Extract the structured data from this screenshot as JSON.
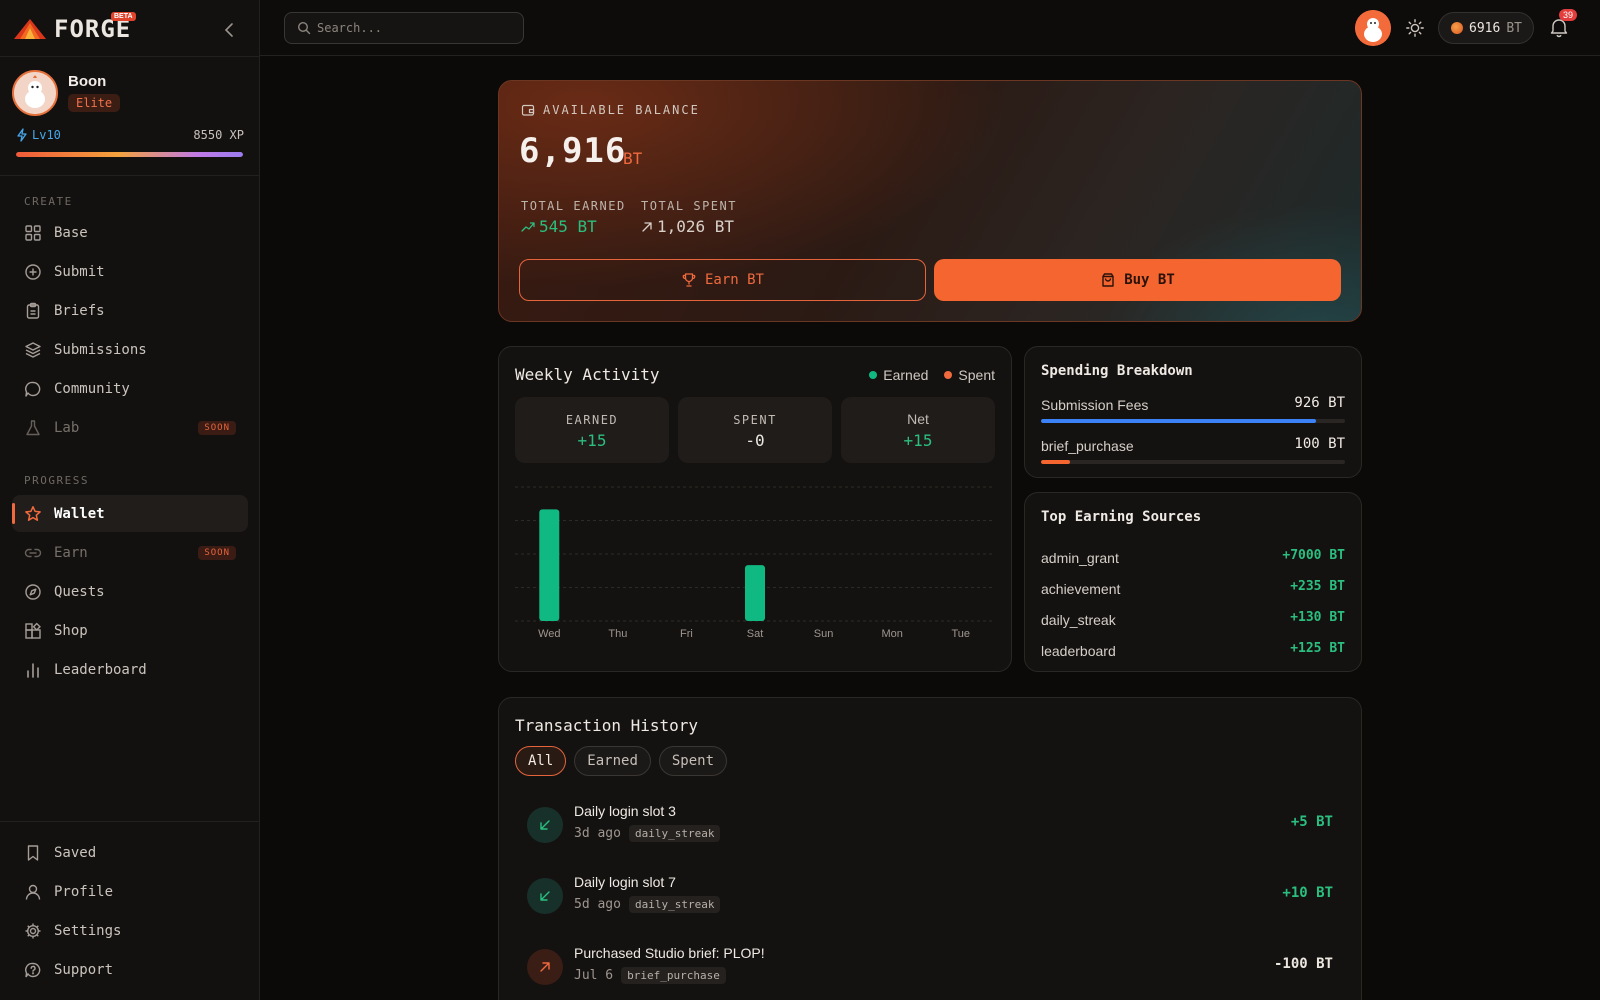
{
  "app": {
    "name": "FORGE",
    "badge": "BETA"
  },
  "user": {
    "name": "Boon",
    "rank": "Elite",
    "level": "Lv10",
    "xp": "8550 XP",
    "xp_progress": 1.0
  },
  "sidebar": {
    "create_label": "CREATE",
    "create_items": [
      {
        "label": "Base",
        "icon": "grid-icon"
      },
      {
        "label": "Submit",
        "icon": "plus-circle-icon"
      },
      {
        "label": "Briefs",
        "icon": "clipboard-icon"
      },
      {
        "label": "Submissions",
        "icon": "layers-icon"
      },
      {
        "label": "Community",
        "icon": "chat-icon"
      },
      {
        "label": "Lab",
        "icon": "flask-icon",
        "badge": "SOON"
      }
    ],
    "progress_label": "PROGRESS",
    "progress_items": [
      {
        "label": "Wallet",
        "icon": "star-icon"
      },
      {
        "label": "Earn",
        "icon": "link-icon",
        "badge": "SOON"
      },
      {
        "label": "Quests",
        "icon": "compass-icon"
      },
      {
        "label": "Shop",
        "icon": "shop-icon"
      },
      {
        "label": "Leaderboard",
        "icon": "bar-chart-icon"
      }
    ],
    "bottom_items": [
      {
        "label": "Saved",
        "icon": "bookmark-icon"
      },
      {
        "label": "Profile",
        "icon": "user-icon"
      },
      {
        "label": "Settings",
        "icon": "gear-icon"
      },
      {
        "label": "Support",
        "icon": "help-icon"
      }
    ]
  },
  "topbar": {
    "search_placeholder": "Search...",
    "balance": "6916",
    "balance_unit": "BT",
    "notifications": "39"
  },
  "balance_card": {
    "label": "AVAILABLE BALANCE",
    "value": "6,916",
    "unit": "BT",
    "total_earned_label": "TOTAL EARNED",
    "total_earned": "545 BT",
    "total_spent_label": "TOTAL SPENT",
    "total_spent": "1,026 BT",
    "earn_button": "Earn BT",
    "buy_button": "Buy BT"
  },
  "weekly": {
    "title": "Weekly Activity",
    "legend_earned": "Earned",
    "legend_spent": "Spent",
    "earned_label": "EARNED",
    "earned_value": "+15",
    "spent_label": "SPENT",
    "spent_value": "-0",
    "net_label": "Net",
    "net_value": "+15"
  },
  "chart_data": {
    "type": "bar",
    "categories": [
      "Wed",
      "Thu",
      "Fri",
      "Sat",
      "Sun",
      "Mon",
      "Tue"
    ],
    "series": [
      {
        "name": "Earned",
        "values": [
          10,
          0,
          0,
          5,
          0,
          0,
          0
        ]
      },
      {
        "name": "Spent",
        "values": [
          0,
          0,
          0,
          0,
          0,
          0,
          0
        ]
      }
    ],
    "ylim": [
      0,
      12
    ],
    "grid": true
  },
  "spending": {
    "title": "Spending Breakdown",
    "items": [
      {
        "name": "Submission Fees",
        "amount": "926 BT",
        "share": 0.903
      },
      {
        "name": "brief_purchase",
        "amount": "100 BT",
        "share": 0.097
      }
    ]
  },
  "sources": {
    "title": "Top Earning Sources",
    "items": [
      {
        "name": "admin_grant",
        "amount": "+7000 BT"
      },
      {
        "name": "achievement",
        "amount": "+235 BT"
      },
      {
        "name": "daily_streak",
        "amount": "+130 BT"
      },
      {
        "name": "leaderboard",
        "amount": "+125 BT"
      }
    ]
  },
  "transactions": {
    "title": "Transaction History",
    "filters": [
      "All",
      "Earned",
      "Spent"
    ],
    "items": [
      {
        "title": "Daily login slot 3",
        "time": "3d ago",
        "tag": "daily_streak",
        "amount": "+5 BT",
        "direction": "in"
      },
      {
        "title": "Daily login slot 7",
        "time": "5d ago",
        "tag": "daily_streak",
        "amount": "+10 BT",
        "direction": "in"
      },
      {
        "title": "Purchased Studio brief: PLOP!",
        "time": "Jul 6",
        "tag": "brief_purchase",
        "amount": "-100 BT",
        "direction": "out"
      }
    ]
  },
  "colors": {
    "accent": "#f4652f",
    "earned": "#10b981",
    "spent": "#f06a3e",
    "level": "#46a8ea"
  }
}
